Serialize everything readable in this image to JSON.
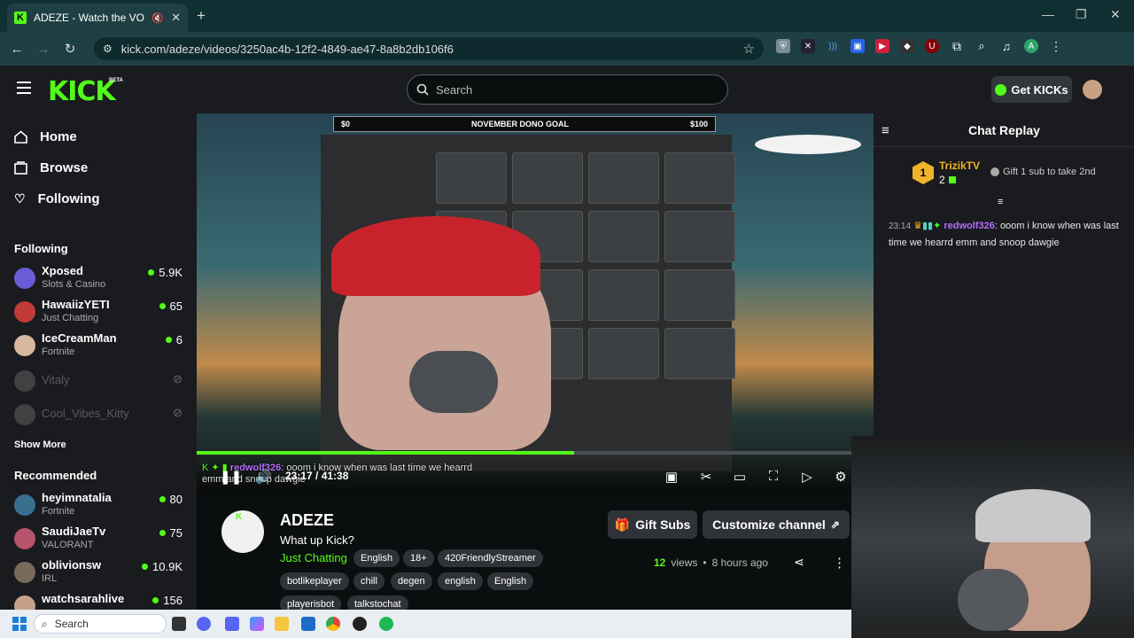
{
  "browser": {
    "tab_title": "ADEZE - Watch the VOD on",
    "url": "kick.com/adeze/videos/3250ac4b-12f2-4849-ae47-8a8b2db106f6",
    "profile_initial": "A"
  },
  "header": {
    "logo": "KICK",
    "logo_badge": "BETA",
    "search_placeholder": "Search",
    "get_kicks": "Get KICKs"
  },
  "sidebar": {
    "nav": [
      {
        "label": "Home",
        "icon": "home-icon"
      },
      {
        "label": "Browse",
        "icon": "browse-icon"
      },
      {
        "label": "Following",
        "icon": "heart-icon"
      }
    ],
    "following_title": "Following",
    "following": [
      {
        "name": "Xposed",
        "category": "Slots & Casino",
        "viewers": "5.9K",
        "live": true
      },
      {
        "name": "HawaiizYETI",
        "category": "Just Chatting",
        "viewers": "65",
        "live": true
      },
      {
        "name": "IceCreamMan",
        "category": "Fortnite",
        "viewers": "6",
        "live": true
      },
      {
        "name": "Vitaly",
        "category": "",
        "viewers": "",
        "live": false
      },
      {
        "name": "Cool_Vibes_Kitty",
        "category": "",
        "viewers": "",
        "live": false
      }
    ],
    "show_more": "Show More",
    "recommended_title": "Recommended",
    "recommended": [
      {
        "name": "heyimnatalia",
        "category": "Fortnite",
        "viewers": "80"
      },
      {
        "name": "SaudiJaeTv",
        "category": "VALORANT",
        "viewers": "75"
      },
      {
        "name": "oblivionsw",
        "category": "IRL",
        "viewers": "10.9K"
      },
      {
        "name": "watchsarahlive",
        "category": "",
        "viewers": "156"
      }
    ]
  },
  "player": {
    "dono_left": "$0",
    "dono_title": "NOVEMBER DONO GOAL",
    "dono_right": "$100",
    "progress_fraction": 0.557,
    "time": "23:17 / 41:38",
    "overlay_user": "redwolf326",
    "overlay_text": ": ooom i know when was last time we hearrd emm and snoop dawgie"
  },
  "channel": {
    "name": "ADEZE",
    "stream_title": "What up Kick?",
    "category": "Just Chatting",
    "tags": [
      "English",
      "18+",
      "420FriendlyStreamer",
      "botlikeplayer",
      "chill",
      "degen",
      "english",
      "English",
      "playerisbot",
      "talkstochat"
    ],
    "gift_subs": "Gift Subs",
    "customize": "Customize channel",
    "views_count": "12",
    "views_label": "views",
    "time_ago": "8 hours ago"
  },
  "chat": {
    "title": "Chat Replay",
    "pinned_rank": "1",
    "pinned_user": "TrizikTV",
    "pinned_count": "2",
    "gift_prompt": "Gift 1 sub to take 2nd",
    "message_time": "23:14",
    "message_user": "redwolf326",
    "message_text": ": ooom i know when was last time we hearrd emm and snoop dawgie"
  },
  "taskbar": {
    "search_placeholder": "Search"
  },
  "colors": {
    "kick_green": "#53fc18",
    "username_purple": "#b46bff",
    "gold": "#f0b429"
  }
}
